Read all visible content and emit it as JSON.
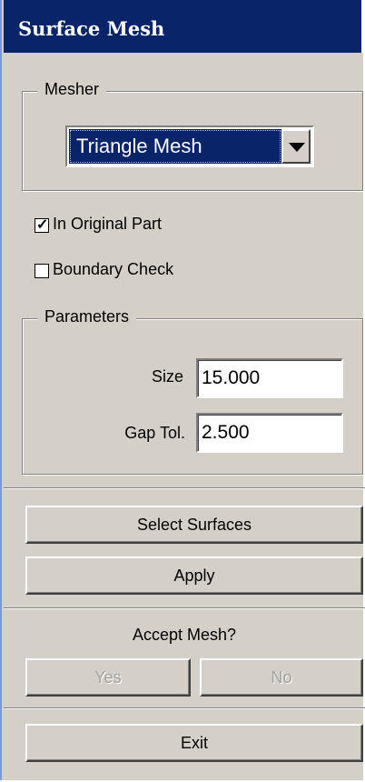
{
  "window": {
    "title": "Surface Mesh"
  },
  "mesher": {
    "group_label": "Mesher",
    "selected": "Triangle Mesh"
  },
  "options": {
    "in_original_part": {
      "label": "In Original Part",
      "checked": true
    },
    "boundary_check": {
      "label": "Boundary Check",
      "checked": false
    }
  },
  "parameters": {
    "group_label": "Parameters",
    "size": {
      "label": "Size",
      "value": "15.000"
    },
    "gap_tol": {
      "label": "Gap Tol.",
      "value": "2.500"
    }
  },
  "buttons": {
    "select_surfaces": "Select Surfaces",
    "apply": "Apply",
    "exit": "Exit"
  },
  "accept": {
    "prompt": "Accept Mesh?",
    "yes": "Yes",
    "no": "No"
  },
  "checkmark_glyph": "✓"
}
